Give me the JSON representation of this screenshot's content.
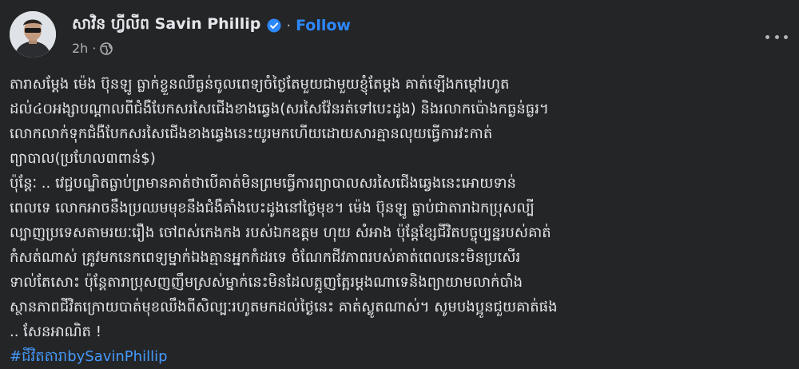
{
  "post": {
    "author_name": "សាវិន ហ្វីលីព Savin Phillip",
    "follow_label": "Follow",
    "timestamp": "2h",
    "icons": {
      "verified": "verified-badge-icon",
      "privacy": "globe-icon",
      "more": "more-options-icon"
    },
    "colors": {
      "background": "#242526",
      "text": "#e4e6eb",
      "link": "#2d88ff",
      "muted": "#b0b3b8"
    },
    "text_lines": [
      "តារាសម្តែង ម៉េង ប៊ុនឡូ ធ្លាក់ខ្លួនឈឺធ្ងន់ចូលពេទ្យចំថ្ងៃតែមួយជាមួយខ្ញុំតែម្តង គាត់ឡើងកម្តៅរហូត",
      "ដល់៤០អង្សាបណ្តាលពីជំងឺបែកសរសៃជើងខាងឆ្វេង(សរសៃវ៉ែនរត់ទៅបេះដូង) និងរលាកប៉ោងកធ្ងន់ធ្ងរ។",
      "លោកលាក់ទុកជំងឺបែកសរសៃជើងខាងឆ្វេងនេះយូរមកហើយដោយសារគ្មានលុយធ្វើការវះកាត់",
      "ព្យាបាល(ប្រហែល៣ពាន់$)",
      "ប៉ុន្តែៈ .. វេជ្ជបណ្ឌិតធ្លាប់ព្រមានគាត់ថាបើគាត់មិនព្រមធ្វើការព្យាបាលសរសៃជើងឆ្វេងនេះអោយទាន់",
      "ពេលទេ លោកអាចនឹងប្រឈមមុខនឹងជំងឺគាំងបេះដូងនៅថ្ងៃមុខ។ ម៉េង ប៊ុនឡូ ធ្លាប់ជាតារាឯកប្រុសល្បី",
      "ល្បាញប្រទេសតាមរយៈរឿង ចៅពស់កេងកង របស់ឯកឧត្តម ហុយ សំអាង ប៉ុន្តែខ្សែជីវិតបច្ចុប្បន្នរបស់គាត់",
      "កំសត់ណាស់ គ្រូវមកនេកពេទ្យម្នាក់ឯងគ្មានអ្នកកំដរទេ ចំណែកជីវភាពរបស់គាត់ពេលនេះមិនប្រសើរ",
      "ទាល់តែសោះ ប៉ុន្តែតារាប្រុសញញឹមស្រស់ម្នាក់នេះមិនដែលត្អូញត្អែរម្តងណាទេនិងព្យាយាមលាក់បាំង",
      "ស្ថានភាពជីវិតក្រោយបាត់មុខឈឹងពីសិល្បៈរហូតមកដល់ថ្ងៃនេះ គាត់ស្លូតណាស់។ សូមបងប្អូនជួយគាត់ផង",
      ".. សែនអាណិត !"
    ],
    "hashtag": "#ជីវិតតារាbySavinPhillip"
  }
}
